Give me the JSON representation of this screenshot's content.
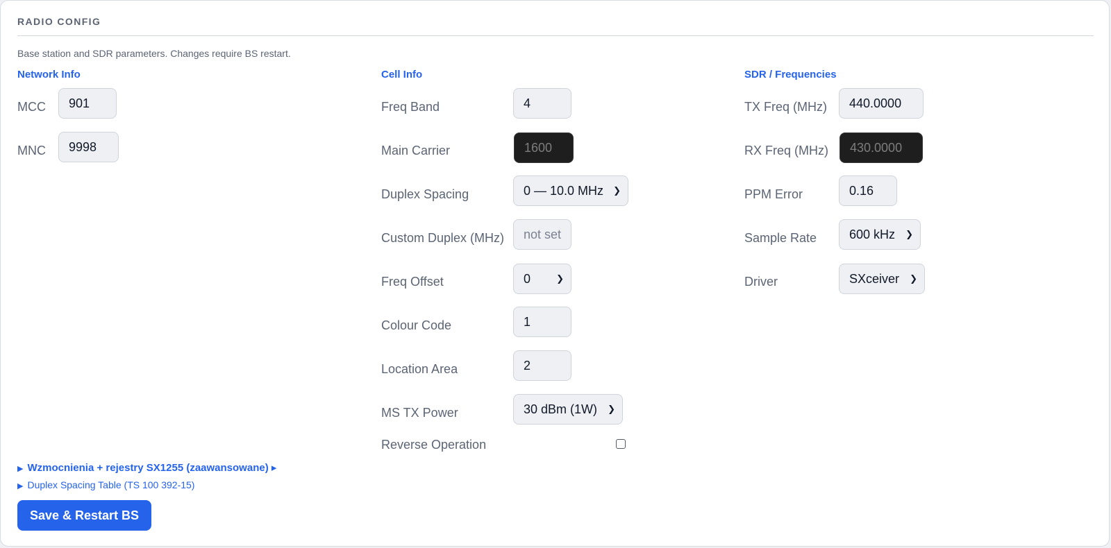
{
  "section": {
    "title": "RADIO CONFIG",
    "description": "Base station and SDR parameters. Changes require BS restart."
  },
  "network_info": {
    "heading": "Network Info",
    "mcc": {
      "label": "MCC",
      "value": "901"
    },
    "mnc": {
      "label": "MNC",
      "value": "9998"
    }
  },
  "cell_info": {
    "heading": "Cell Info",
    "freq_band": {
      "label": "Freq Band",
      "value": "4"
    },
    "main_carrier": {
      "label": "Main Carrier",
      "value": "1600"
    },
    "duplex_spacing": {
      "label": "Duplex Spacing",
      "value": "0 — 10.0 MHz"
    },
    "custom_duplex": {
      "label": "Custom Duplex (MHz)",
      "placeholder": "not set"
    },
    "freq_offset": {
      "label": "Freq Offset",
      "value": "0"
    },
    "colour_code": {
      "label": "Colour Code",
      "value": "1"
    },
    "location_area": {
      "label": "Location Area",
      "value": "2"
    },
    "ms_tx_power": {
      "label": "MS TX Power",
      "value": "30 dBm (1W)"
    },
    "reverse_operation": {
      "label": "Reverse Operation",
      "checked": false
    }
  },
  "sdr": {
    "heading": "SDR / Frequencies",
    "tx_freq": {
      "label": "TX Freq (MHz)",
      "value": "440.0000"
    },
    "rx_freq": {
      "label": "RX Freq (MHz)",
      "value": "430.0000"
    },
    "ppm_error": {
      "label": "PPM Error",
      "value": "0.16"
    },
    "sample_rate": {
      "label": "Sample Rate",
      "value": "600 kHz"
    },
    "driver": {
      "label": "Driver",
      "value": "SXceiver"
    }
  },
  "advanced": {
    "gains_label": "Wzmocnienia + rejestry SX1255 (zaawansowane) ▸",
    "duplex_table_label": "Duplex Spacing Table (TS 100 392-15)"
  },
  "actions": {
    "save_label": "Save & Restart BS"
  },
  "colors": {
    "accent": "#2563eb",
    "readonly_field": "#1e1e1e"
  }
}
